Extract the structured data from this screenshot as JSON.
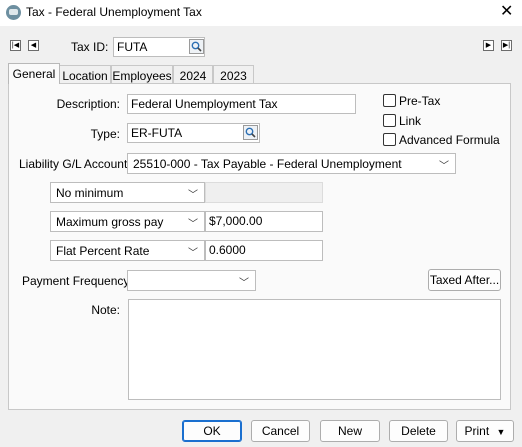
{
  "window": {
    "title": "Tax - Federal Unemployment Tax",
    "close_glyph": "✕"
  },
  "nav": {
    "first": "|◀",
    "prev": "◀",
    "next": "▶",
    "last": "▶|"
  },
  "tax_id": {
    "label": "Tax ID:",
    "value": "FUTA"
  },
  "tabs": [
    {
      "label": "General",
      "active": true
    },
    {
      "label": "Location"
    },
    {
      "label": "Employees"
    },
    {
      "label": "2024"
    },
    {
      "label": "2023"
    }
  ],
  "general": {
    "description_label": "Description:",
    "description_value": "Federal Unemployment Tax",
    "type_label": "Type:",
    "type_value": "ER-FUTA",
    "pretax_label": "Pre-Tax",
    "link_label": "Link",
    "advanced_formula_label": "Advanced Formula",
    "liability_label": "Liability G/L Account:",
    "liability_value": "25510-000 - Tax Payable - Federal Unemployment",
    "minimum_select": "No minimum",
    "minimum_value": "",
    "maximum_select": "Maximum gross pay",
    "maximum_value": "$7,000.00",
    "rate_select": "Flat Percent Rate",
    "rate_value": "0.6000",
    "payment_frequency_label": "Payment Frequency:",
    "payment_frequency_value": "",
    "taxed_after_label": "Taxed After...",
    "note_label": "Note:",
    "note_value": ""
  },
  "footer": {
    "ok_label": "OK",
    "cancel_label": "Cancel",
    "new_label": "New",
    "delete_label": "Delete",
    "print_label": "Print"
  },
  "icons": {
    "chevron": "﹀",
    "dropdown_arrow": "▼"
  },
  "colors": {
    "primary_border": "#1a6fcf"
  }
}
